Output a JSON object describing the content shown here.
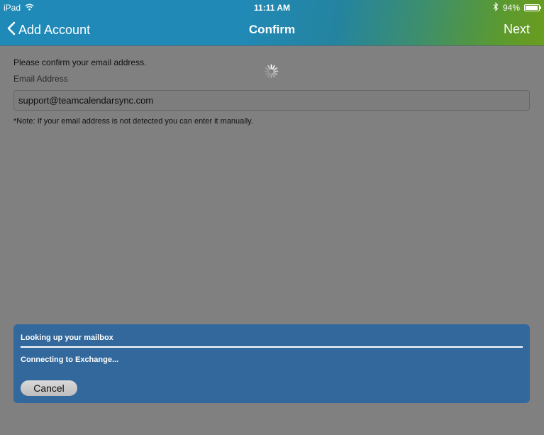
{
  "status_bar": {
    "device": "iPad",
    "time": "11:11 AM",
    "battery": "94%",
    "battery_level": 0.94
  },
  "nav": {
    "back_label": "Add Account",
    "title": "Confirm",
    "next_label": "Next"
  },
  "form": {
    "prompt": "Please confirm your email address.",
    "email_label": "Email Address",
    "email_value": "support@teamcalendarsync.com",
    "note": "*Note: If your email address is not detected you can enter it manually."
  },
  "progress_panel": {
    "title": "Looking up your mailbox",
    "status": "Connecting to Exchange...",
    "cancel_label": "Cancel"
  },
  "colors": {
    "panel": "#33689c",
    "overlay": "#808080",
    "header_start": "#1f89b8",
    "header_end": "#6a9c1e"
  },
  "icons": {
    "wifi": "wifi-icon",
    "bluetooth": "bluetooth-icon",
    "battery": "battery-icon",
    "back": "chevron-left-icon",
    "spinner": "spinner-icon"
  }
}
